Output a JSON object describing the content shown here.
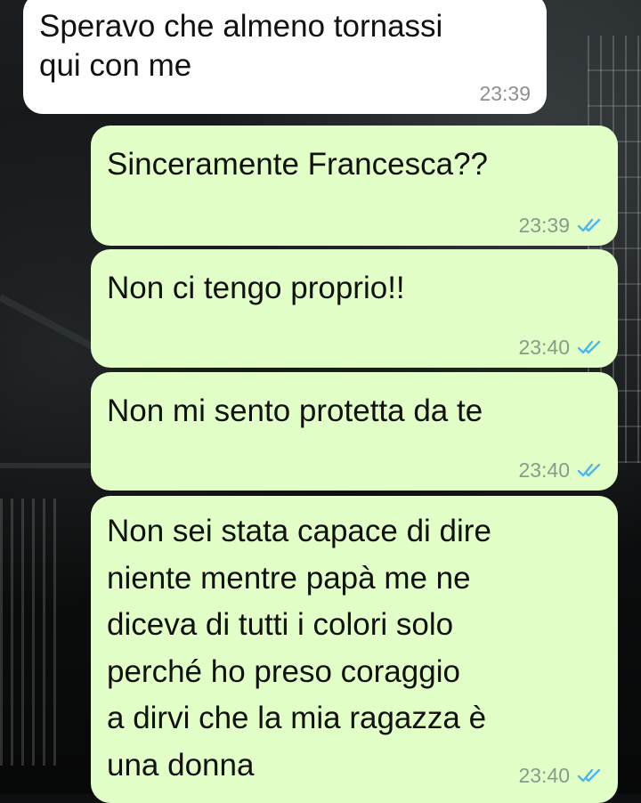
{
  "colors": {
    "incoming_bubble": "#ffffff",
    "outgoing_bubble": "#e1ffc7",
    "read_ticks": "#4fb6ec"
  },
  "messages": [
    {
      "direction": "incoming",
      "text": "Speravo che almeno tornassi\nqui con me",
      "time": "23:39"
    },
    {
      "direction": "outgoing",
      "text": "Sinceramente Francesca??",
      "time": "23:39",
      "status_icon": "double-check-read-icon"
    },
    {
      "direction": "outgoing",
      "text": "Non ci tengo proprio!!",
      "time": "23:40",
      "status_icon": "double-check-read-icon"
    },
    {
      "direction": "outgoing",
      "text": "Non mi sento protetta da te",
      "time": "23:40",
      "status_icon": "double-check-read-icon"
    },
    {
      "direction": "outgoing",
      "text": "Non sei stata capace di dire\nniente mentre papà me ne\ndiceva di tutti i colori solo\nperché ho preso coraggio\na dirvi che la mia ragazza è\nuna donna",
      "time": "23:40",
      "status_icon": "double-check-read-icon"
    }
  ]
}
